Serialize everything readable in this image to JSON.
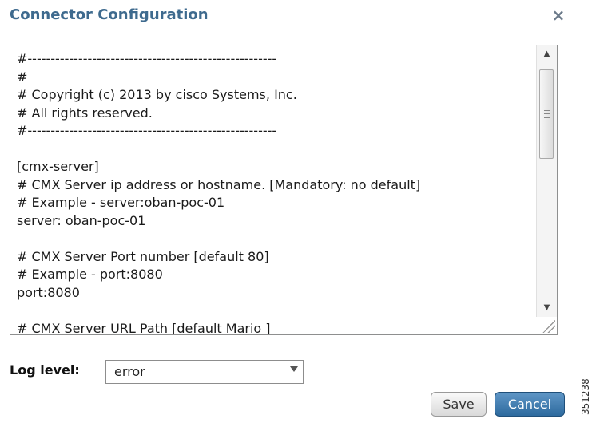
{
  "dialog": {
    "title": "Connector Configuration",
    "close_icon": "×"
  },
  "editor": {
    "lines": [
      "#------------------------------------------------------",
      "#",
      "# Copyright (c) 2013 by cisco Systems, Inc.",
      "# All rights reserved.",
      "#------------------------------------------------------",
      "",
      "[cmx-server]",
      "# CMX Server ip address or hostname. [Mandatory: no default]",
      "# Example - server:oban-poc-01",
      "server: oban-poc-01",
      "",
      "# CMX Server Port number [default 80]",
      "# Example - port:8080",
      "port:8080",
      "",
      "# CMX Server URL Path [default Mario ]"
    ]
  },
  "log_level": {
    "label": "Log level:",
    "value": "error"
  },
  "buttons": {
    "save": "Save",
    "cancel": "Cancel"
  },
  "figure_id": "351238"
}
